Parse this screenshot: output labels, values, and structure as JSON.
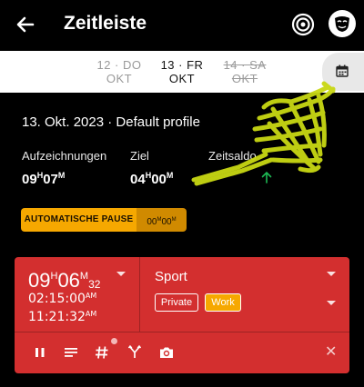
{
  "app": {
    "title": "Zeitleiste"
  },
  "datebar": {
    "prev": {
      "day": "12 · DO",
      "month": "OKT"
    },
    "current": {
      "day": "13 · FR",
      "month": "OKT"
    },
    "next": {
      "day": "14 · SA",
      "month": "OKT"
    }
  },
  "summary": {
    "date_profile": "13. Okt. 2023 · Default profile",
    "recorded": {
      "label": "Aufzeichnungen",
      "hours": "09",
      "minutes": "07",
      "h_unit": "H",
      "m_unit": "M"
    },
    "goal": {
      "label": "Ziel",
      "hours": "04",
      "minutes": "00",
      "h_unit": "H",
      "m_unit": "M"
    },
    "balance": {
      "label": "Zeitsaldo"
    }
  },
  "pause": {
    "label": "AUTOMATISCHE PAUSE",
    "minutes": "00",
    "seconds": "00",
    "m_unit": "M",
    "s_unit": "M"
  },
  "entry": {
    "duration": {
      "hours": "09",
      "minutes": "06",
      "seconds": "32",
      "h_unit": "H",
      "m_unit": "M"
    },
    "start": {
      "time": "02:15:00",
      "ampm": "AM"
    },
    "end": {
      "time": "11:21:32",
      "ampm": "AM"
    },
    "project": "Sport",
    "tags": [
      "Private",
      "Work"
    ]
  },
  "colors": {
    "card": "#d32f2f",
    "accent": "#f6a800",
    "highlight": "#c9d814",
    "positive": "#1db954"
  },
  "icons": [
    "back-arrow-icon",
    "target-icon",
    "mask-icon",
    "calendar-icon",
    "pause-icon",
    "notes-icon",
    "hashtag-icon",
    "fork-icon",
    "camera-icon",
    "close-icon"
  ]
}
